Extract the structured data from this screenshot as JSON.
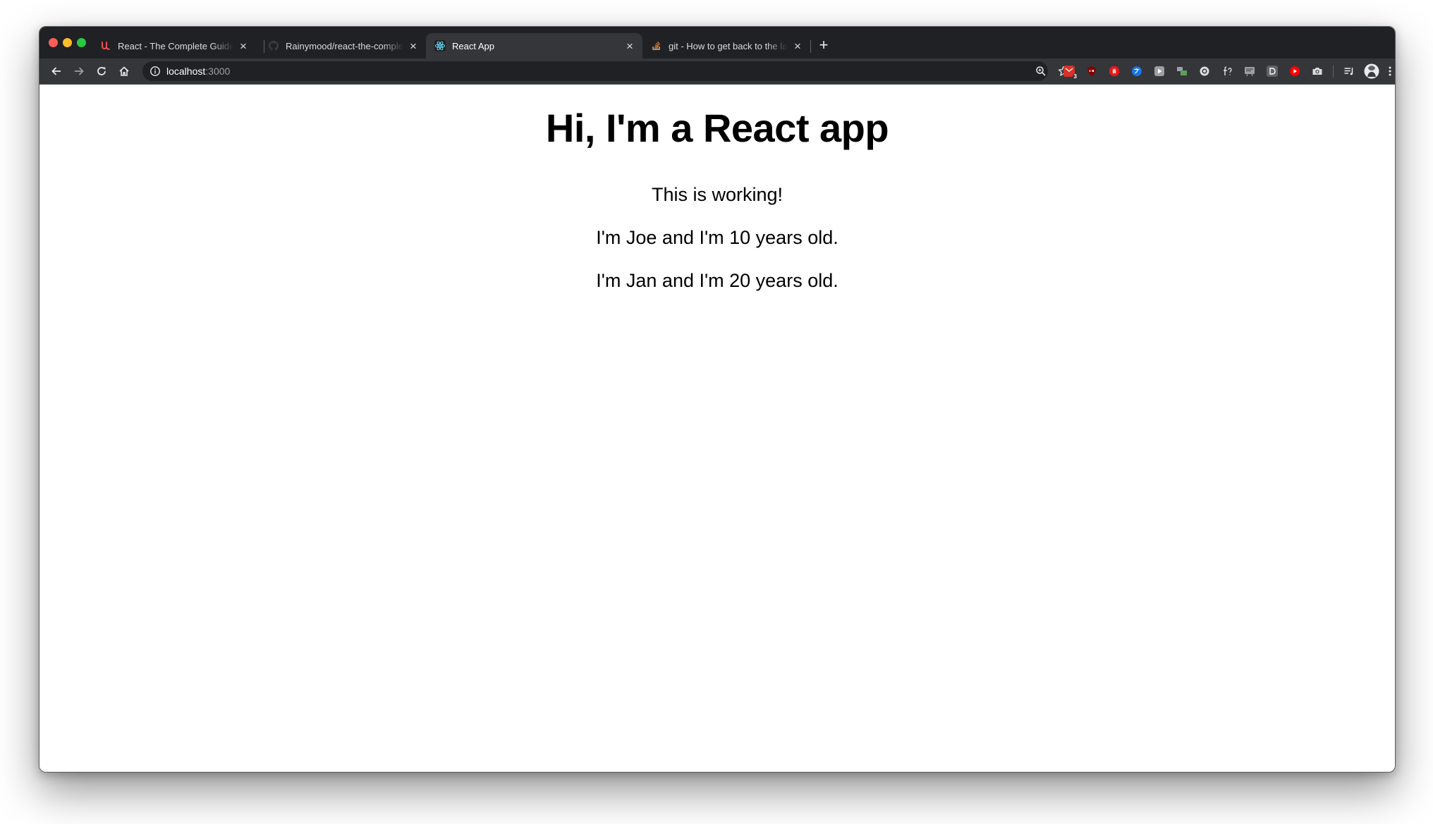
{
  "browser": {
    "tabs": [
      {
        "title": "React - The Complete Guide (incl Hooks, React Router, Redux)",
        "favicon": "udemy-icon",
        "active": false
      },
      {
        "title": "Rainymood/react-the-complete-guide",
        "favicon": "github-icon",
        "active": false
      },
      {
        "title": "React App",
        "favicon": "react-icon",
        "active": true
      },
      {
        "title": "git - How to get back to the latest commit",
        "favicon": "stackoverflow-icon",
        "active": false
      }
    ],
    "newtab_glyph": "+",
    "close_glyph": "×",
    "address": {
      "host": "localhost",
      "port": ":3000"
    },
    "extensions": [
      {
        "name": "gmail-checker-extension",
        "badge": "3",
        "color": "#d93025"
      },
      {
        "name": "ublock-extension",
        "color": "#800000"
      },
      {
        "name": "adblock-extension",
        "color": "#e8191b"
      },
      {
        "name": "translate-extension",
        "color": "#1a73e8"
      },
      {
        "name": "video-extension",
        "color": "#9aa0a6"
      },
      {
        "name": "tab-manager-extension",
        "color": "#5f9e5f"
      },
      {
        "name": "record-extension",
        "color": "#dadce0"
      },
      {
        "name": "font-extension",
        "color": "#dadce0"
      },
      {
        "name": "screenshot-extension",
        "color": "#9aa0a6"
      },
      {
        "name": "d-extension",
        "color": "#5f6368"
      },
      {
        "name": "youtube-extension",
        "color": "#ff0000"
      },
      {
        "name": "camera-extension",
        "color": "#dadce0"
      }
    ]
  },
  "page": {
    "heading": "Hi, I'm a React app",
    "status": "This is working!",
    "persons": [
      "I'm Joe and I'm 10 years old.",
      "I'm Jan and I'm 20 years old."
    ]
  }
}
